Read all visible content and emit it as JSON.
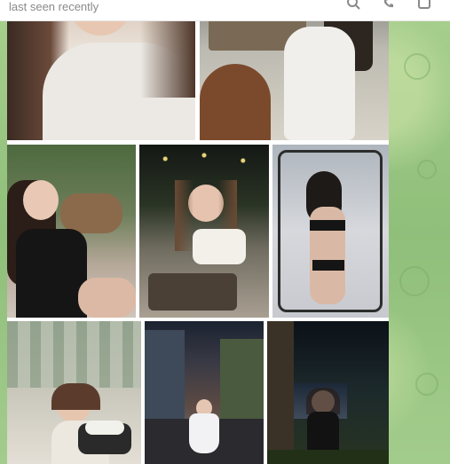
{
  "header": {
    "status_text": "last seen recently",
    "icons": [
      "search-icon",
      "phone-icon",
      "more-icon"
    ]
  },
  "album": {
    "photos": [
      {
        "name": "photo-1",
        "scene": "girl-white-shirt-closeup"
      },
      {
        "name": "photo-2",
        "scene": "girl-white-dress-restaurant"
      },
      {
        "name": "photo-3",
        "scene": "girl-black-dress-teddy-bears"
      },
      {
        "name": "photo-4",
        "scene": "girl-dinner-table-lights"
      },
      {
        "name": "photo-5",
        "scene": "girl-mirror-selfie"
      },
      {
        "name": "photo-6",
        "scene": "girl-flowers-window"
      },
      {
        "name": "photo-7",
        "scene": "girl-street-night"
      },
      {
        "name": "photo-8",
        "scene": "girl-black-dress-night"
      }
    ]
  },
  "colors": {
    "wallpaper": "#9cc58a",
    "header_bg": "#ffffff",
    "status_text": "#8a8a8a"
  }
}
